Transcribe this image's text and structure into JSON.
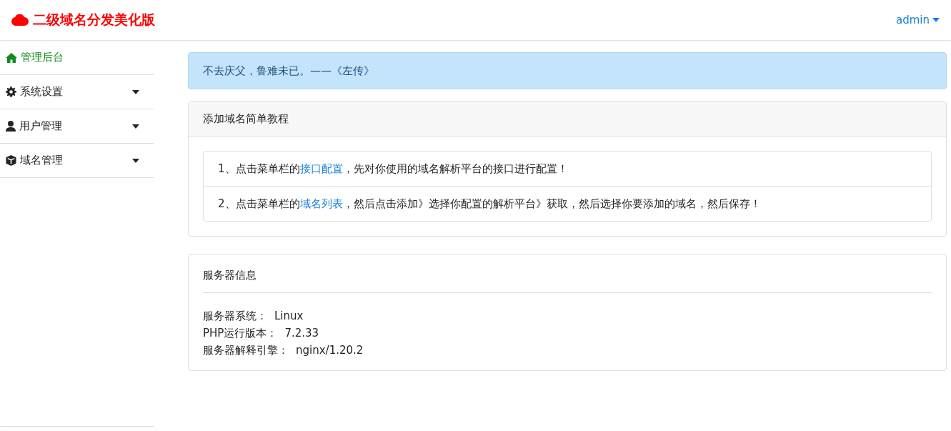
{
  "header": {
    "brand": "二级域名分发美化版",
    "user": "admin"
  },
  "sidebar": {
    "items": [
      {
        "label": "管理后台",
        "selected": true,
        "expandable": false
      },
      {
        "label": "系统设置",
        "selected": false,
        "expandable": true
      },
      {
        "label": "用户管理",
        "selected": false,
        "expandable": true
      },
      {
        "label": "域名管理",
        "selected": false,
        "expandable": true
      }
    ]
  },
  "quote": "不去庆父，鲁难未已。——《左传》",
  "tutorial": {
    "title": "添加域名简单教程",
    "steps": [
      {
        "before": "1、点击菜单栏的",
        "link": "接口配置",
        "after": "，先对你使用的域名解析平台的接口进行配置！"
      },
      {
        "before": "2、点击菜单栏的",
        "link": "域名列表",
        "after": "，然后点击添加》选择你配置的解析平台》获取，然后选择你要添加的域名，然后保存！"
      }
    ]
  },
  "server_info": {
    "title": "服务器信息",
    "rows": [
      {
        "label": "服务器系统：",
        "value": "Linux"
      },
      {
        "label": "PHP运行版本：",
        "value": "7.2.33"
      },
      {
        "label": "服务器解释引擎：",
        "value": "nginx/1.20.2"
      }
    ]
  }
}
